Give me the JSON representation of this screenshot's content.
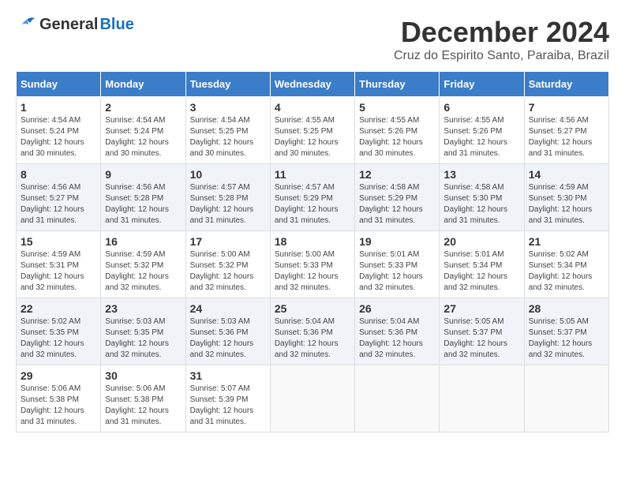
{
  "header": {
    "logo_general": "General",
    "logo_blue": "Blue",
    "month": "December 2024",
    "location": "Cruz do Espirito Santo, Paraiba, Brazil"
  },
  "weekdays": [
    "Sunday",
    "Monday",
    "Tuesday",
    "Wednesday",
    "Thursday",
    "Friday",
    "Saturday"
  ],
  "weeks": [
    [
      {
        "day": "1",
        "sunrise": "4:54 AM",
        "sunset": "5:24 PM",
        "daylight": "12 hours and 30 minutes."
      },
      {
        "day": "2",
        "sunrise": "4:54 AM",
        "sunset": "5:24 PM",
        "daylight": "12 hours and 30 minutes."
      },
      {
        "day": "3",
        "sunrise": "4:54 AM",
        "sunset": "5:25 PM",
        "daylight": "12 hours and 30 minutes."
      },
      {
        "day": "4",
        "sunrise": "4:55 AM",
        "sunset": "5:25 PM",
        "daylight": "12 hours and 30 minutes."
      },
      {
        "day": "5",
        "sunrise": "4:55 AM",
        "sunset": "5:26 PM",
        "daylight": "12 hours and 30 minutes."
      },
      {
        "day": "6",
        "sunrise": "4:55 AM",
        "sunset": "5:26 PM",
        "daylight": "12 hours and 31 minutes."
      },
      {
        "day": "7",
        "sunrise": "4:56 AM",
        "sunset": "5:27 PM",
        "daylight": "12 hours and 31 minutes."
      }
    ],
    [
      {
        "day": "8",
        "sunrise": "4:56 AM",
        "sunset": "5:27 PM",
        "daylight": "12 hours and 31 minutes."
      },
      {
        "day": "9",
        "sunrise": "4:56 AM",
        "sunset": "5:28 PM",
        "daylight": "12 hours and 31 minutes."
      },
      {
        "day": "10",
        "sunrise": "4:57 AM",
        "sunset": "5:28 PM",
        "daylight": "12 hours and 31 minutes."
      },
      {
        "day": "11",
        "sunrise": "4:57 AM",
        "sunset": "5:29 PM",
        "daylight": "12 hours and 31 minutes."
      },
      {
        "day": "12",
        "sunrise": "4:58 AM",
        "sunset": "5:29 PM",
        "daylight": "12 hours and 31 minutes."
      },
      {
        "day": "13",
        "sunrise": "4:58 AM",
        "sunset": "5:30 PM",
        "daylight": "12 hours and 31 minutes."
      },
      {
        "day": "14",
        "sunrise": "4:59 AM",
        "sunset": "5:30 PM",
        "daylight": "12 hours and 31 minutes."
      }
    ],
    [
      {
        "day": "15",
        "sunrise": "4:59 AM",
        "sunset": "5:31 PM",
        "daylight": "12 hours and 32 minutes."
      },
      {
        "day": "16",
        "sunrise": "4:59 AM",
        "sunset": "5:32 PM",
        "daylight": "12 hours and 32 minutes."
      },
      {
        "day": "17",
        "sunrise": "5:00 AM",
        "sunset": "5:32 PM",
        "daylight": "12 hours and 32 minutes."
      },
      {
        "day": "18",
        "sunrise": "5:00 AM",
        "sunset": "5:33 PM",
        "daylight": "12 hours and 32 minutes."
      },
      {
        "day": "19",
        "sunrise": "5:01 AM",
        "sunset": "5:33 PM",
        "daylight": "12 hours and 32 minutes."
      },
      {
        "day": "20",
        "sunrise": "5:01 AM",
        "sunset": "5:34 PM",
        "daylight": "12 hours and 32 minutes."
      },
      {
        "day": "21",
        "sunrise": "5:02 AM",
        "sunset": "5:34 PM",
        "daylight": "12 hours and 32 minutes."
      }
    ],
    [
      {
        "day": "22",
        "sunrise": "5:02 AM",
        "sunset": "5:35 PM",
        "daylight": "12 hours and 32 minutes."
      },
      {
        "day": "23",
        "sunrise": "5:03 AM",
        "sunset": "5:35 PM",
        "daylight": "12 hours and 32 minutes."
      },
      {
        "day": "24",
        "sunrise": "5:03 AM",
        "sunset": "5:36 PM",
        "daylight": "12 hours and 32 minutes."
      },
      {
        "day": "25",
        "sunrise": "5:04 AM",
        "sunset": "5:36 PM",
        "daylight": "12 hours and 32 minutes."
      },
      {
        "day": "26",
        "sunrise": "5:04 AM",
        "sunset": "5:36 PM",
        "daylight": "12 hours and 32 minutes."
      },
      {
        "day": "27",
        "sunrise": "5:05 AM",
        "sunset": "5:37 PM",
        "daylight": "12 hours and 32 minutes."
      },
      {
        "day": "28",
        "sunrise": "5:05 AM",
        "sunset": "5:37 PM",
        "daylight": "12 hours and 32 minutes."
      }
    ],
    [
      {
        "day": "29",
        "sunrise": "5:06 AM",
        "sunset": "5:38 PM",
        "daylight": "12 hours and 31 minutes."
      },
      {
        "day": "30",
        "sunrise": "5:06 AM",
        "sunset": "5:38 PM",
        "daylight": "12 hours and 31 minutes."
      },
      {
        "day": "31",
        "sunrise": "5:07 AM",
        "sunset": "5:39 PM",
        "daylight": "12 hours and 31 minutes."
      },
      null,
      null,
      null,
      null
    ]
  ]
}
